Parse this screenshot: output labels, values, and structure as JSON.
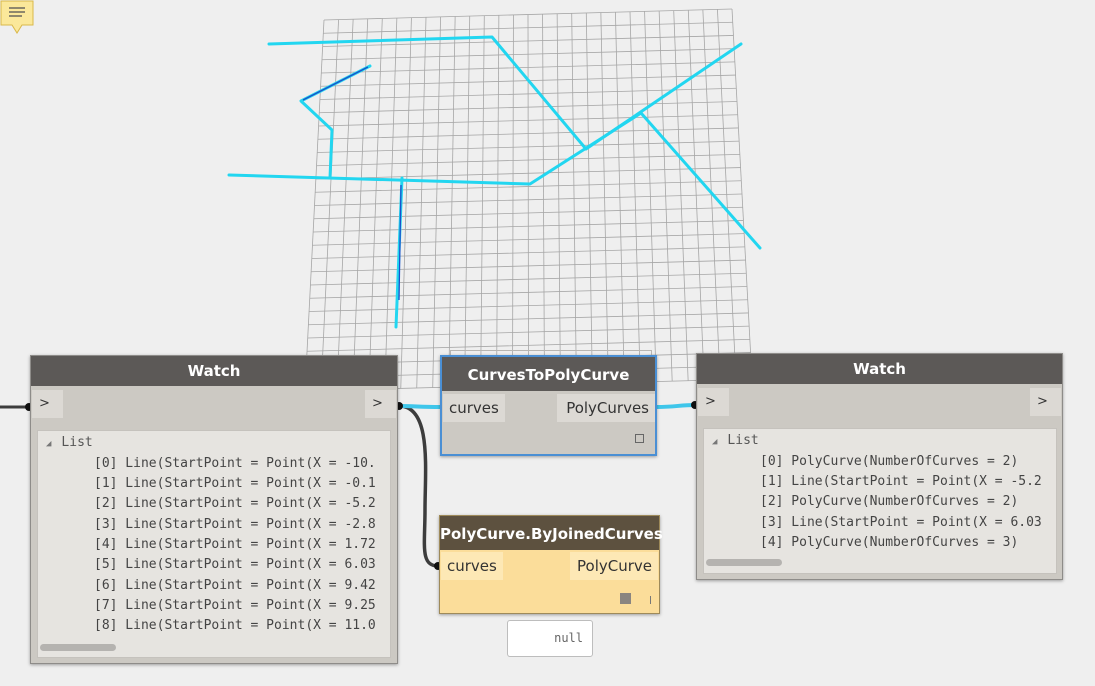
{
  "watch_left": {
    "title": "Watch",
    "in_port": ">",
    "out_port": ">",
    "list_label": "List",
    "items": [
      "[0] Line(StartPoint = Point(X = -10.",
      "[1] Line(StartPoint = Point(X = -0.1",
      "[2] Line(StartPoint = Point(X = -5.2",
      "[3] Line(StartPoint = Point(X = -2.8",
      "[4] Line(StartPoint = Point(X = 1.72",
      "[5] Line(StartPoint = Point(X = 6.03",
      "[6] Line(StartPoint = Point(X = 9.42",
      "[7] Line(StartPoint = Point(X = 9.25",
      "[8] Line(StartPoint = Point(X = 11.0"
    ]
  },
  "curves_to_polycurve": {
    "title": "CurvesToPolyCurve",
    "input": "curves",
    "output": "PolyCurves"
  },
  "watch_right": {
    "title": "Watch",
    "in_port": ">",
    "out_port": ">",
    "list_label": "List",
    "items": [
      "[0] PolyCurve(NumberOfCurves = 2)",
      "[1] Line(StartPoint = Point(X = -5.2",
      "[2] PolyCurve(NumberOfCurves = 2)",
      "[3] Line(StartPoint = Point(X = 6.03",
      "[4] PolyCurve(NumberOfCurves = 3)"
    ]
  },
  "polycurve_joined": {
    "title": "PolyCurve.ByJoinedCurves",
    "input": "curves",
    "output": "PolyCurve",
    "preview_value": "null"
  },
  "colors": {
    "node_header": "#5c5957",
    "node_body": "#ccc9c3",
    "selected_border": "#4a8fd4",
    "warning_body": "#fbdd9a",
    "warning_header": "#5d513f",
    "geometry": "#22d6f0",
    "wire": "#3c3c3c",
    "wire_selected": "#3fc6ea"
  }
}
